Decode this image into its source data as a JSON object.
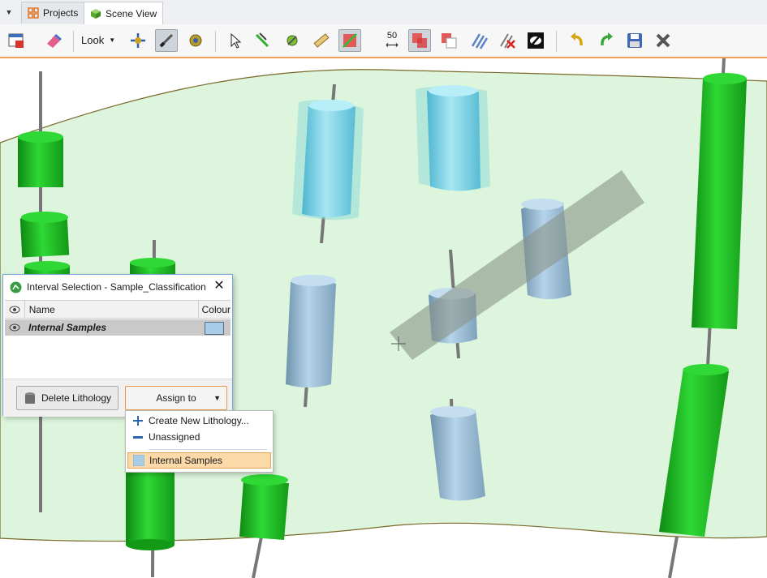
{
  "tabs": [
    {
      "label": "Projects",
      "icon": "projects-grid-icon"
    },
    {
      "label": "Scene View",
      "icon": "scene-cube-icon"
    }
  ],
  "toolbar": {
    "look_label": "Look",
    "tape_value": "50"
  },
  "dialog": {
    "title": "Interval Selection - Sample_Classification",
    "columns": {
      "visibility": "",
      "name": "Name",
      "colour": "Colour"
    },
    "rows": [
      {
        "name": "Internal Samples",
        "colour": "#a9cde8"
      }
    ],
    "delete_button": "Delete Lithology",
    "assign_button": "Assign to"
  },
  "assign_menu": {
    "items": [
      {
        "label": "Create New Lithology...",
        "icon": "plus-icon"
      },
      {
        "label": "Unassigned",
        "icon": "dash-icon"
      },
      {
        "label": "Internal Samples",
        "icon": "lithology-swatch-icon",
        "selected": true
      }
    ]
  },
  "colors": {
    "accent": "#f0a050",
    "scene_surface": "#dcf5dc",
    "drillhole_green": "#1fbf24",
    "sample_blue": "#9ec3de"
  }
}
